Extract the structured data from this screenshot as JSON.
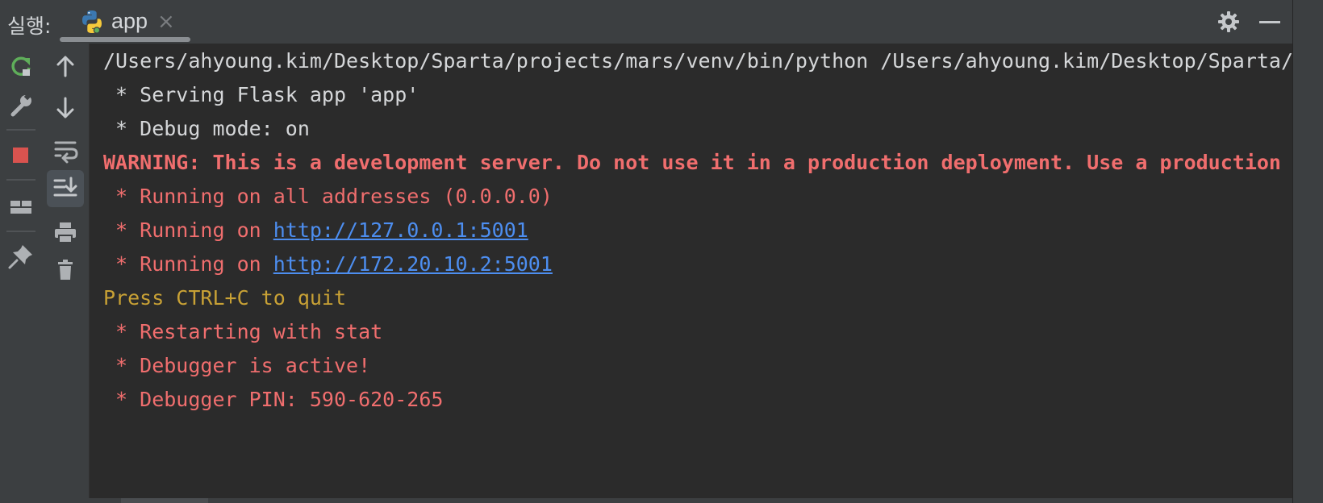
{
  "topbar": {
    "run_label": "실행:",
    "tab_name": "app",
    "tab_close": "×"
  },
  "toolbar": {
    "left": [
      "rerun-icon",
      "wrench-icon",
      "stop-icon",
      "layout-icon",
      "pin-icon"
    ],
    "middle": [
      "arrow-up-icon",
      "arrow-down-icon",
      "soft-wrap-icon",
      "scroll-to-end-icon",
      "print-icon",
      "trash-icon"
    ]
  },
  "colors": {
    "background": "#2b2b2b",
    "panel": "#3c3f41",
    "text": "#d5d7d9",
    "error": "#f06e6e",
    "warning_yellow": "#c8a135",
    "link": "#4d8ef0",
    "rerun_green": "#5fae5a",
    "stop_red": "#d9534f"
  },
  "console": {
    "lines": [
      {
        "text": "/Users/ahyoung.kim/Desktop/Sparta/projects/mars/venv/bin/python /Users/ahyoung.kim/Desktop/Sparta/projects/mars/app.py"
      },
      {
        "text": " * Serving Flask app 'app'"
      },
      {
        "text": " * Debug mode: on"
      },
      {
        "text": "WARNING: This is a development server. Do not use it in a production deployment. Use a production WSGI server instead."
      },
      {
        "text": " * Running on all addresses (0.0.0.0)"
      },
      {
        "prefix": " * Running on ",
        "link": "http://127.0.0.1:5001"
      },
      {
        "prefix": " * Running on ",
        "link": "http://172.20.10.2:5001"
      },
      {
        "text": "Press CTRL+C to quit"
      },
      {
        "text": " * Restarting with stat"
      },
      {
        "text": " * Debugger is active!"
      },
      {
        "text": " * Debugger PIN: 590-620-265"
      }
    ]
  }
}
